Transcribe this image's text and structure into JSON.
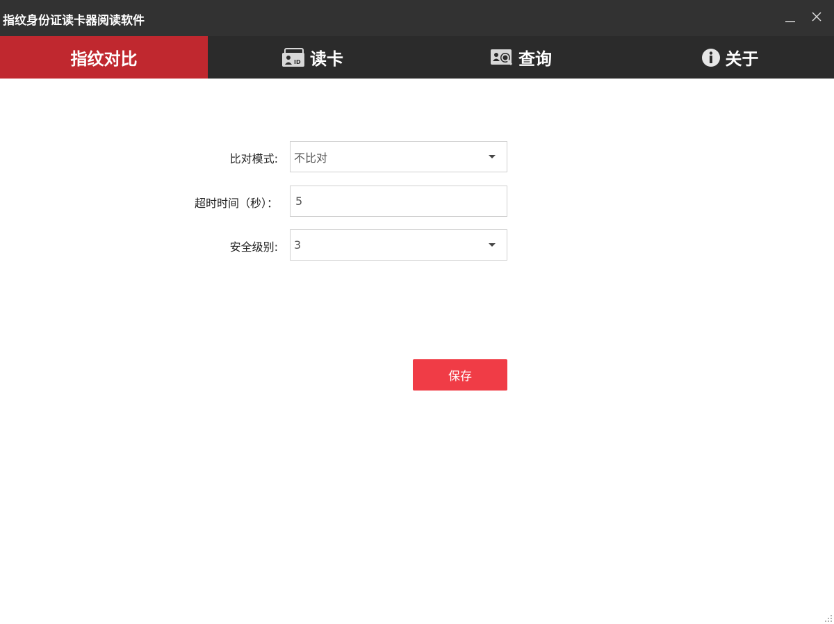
{
  "window": {
    "title": "指纹身份证读卡器阅读软件",
    "minimize_glyph": "—",
    "close_glyph": "✕"
  },
  "tabs": [
    {
      "label": "指纹对比",
      "icon": "",
      "active": true
    },
    {
      "label": "读卡",
      "icon": "id-card-icon",
      "active": false
    },
    {
      "label": "查询",
      "icon": "search-person-icon",
      "active": false
    },
    {
      "label": "关于",
      "icon": "info-icon",
      "active": false
    }
  ],
  "form": {
    "compare_mode": {
      "label": "比对模式:",
      "value": "不比对"
    },
    "timeout": {
      "label": "超时时间（秒）：",
      "value": "5"
    },
    "security_level": {
      "label": "安全级别:",
      "value": "3"
    },
    "save_label": "保存"
  },
  "colors": {
    "titlebar": "#323232",
    "navbar": "#2b2b2b",
    "active_tab": "#c0282f",
    "save_button": "#f03c46"
  }
}
